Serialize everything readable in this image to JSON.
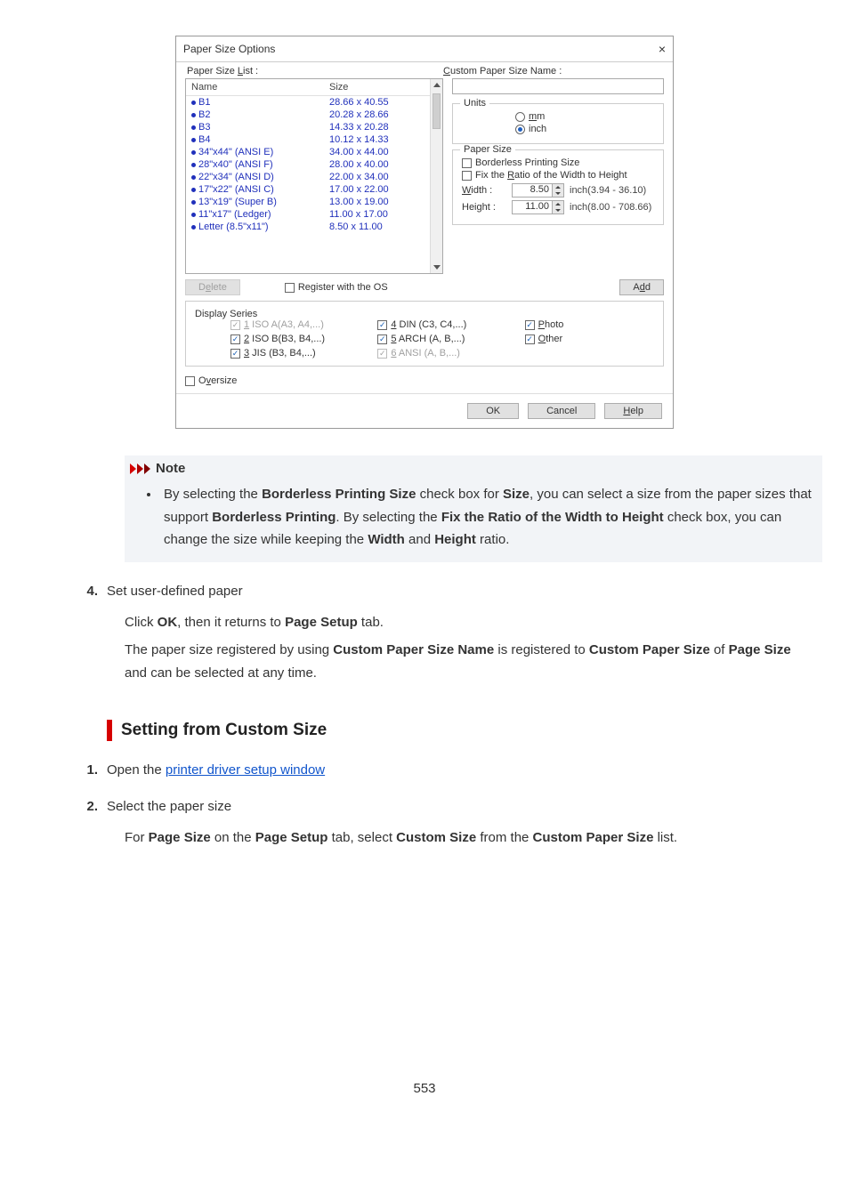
{
  "dialog": {
    "title": "Paper Size Options",
    "close": "×",
    "listLabel": {
      "pre": "Paper Size ",
      "u": "L",
      "post": "ist :"
    },
    "nameLabel": {
      "u": "C",
      "post": "ustom Paper Size Name :"
    },
    "headers": {
      "name": "Name",
      "size": "Size"
    },
    "rows": [
      {
        "name": "B1",
        "size": "28.66 x 40.55"
      },
      {
        "name": "B2",
        "size": "20.28 x 28.66"
      },
      {
        "name": "B3",
        "size": "14.33 x 20.28"
      },
      {
        "name": "B4",
        "size": "10.12 x 14.33"
      },
      {
        "name": "34\"x44\" (ANSI E)",
        "size": "34.00 x 44.00"
      },
      {
        "name": "28\"x40\" (ANSI F)",
        "size": "28.00 x 40.00"
      },
      {
        "name": "22\"x34\" (ANSI D)",
        "size": "22.00 x 34.00"
      },
      {
        "name": "17\"x22\" (ANSI C)",
        "size": "17.00 x 22.00"
      },
      {
        "name": "13\"x19\" (Super B)",
        "size": "13.00 x 19.00"
      },
      {
        "name": "11\"x17\" (Ledger)",
        "size": "11.00 x 17.00"
      },
      {
        "name": "Letter (8.5\"x11\")",
        "size": "8.50 x 11.00"
      }
    ],
    "units": {
      "legend": "Units",
      "mm": {
        "u": "m",
        "post": "m"
      },
      "inch": "inch"
    },
    "paperSize": {
      "legend": "Paper Size",
      "borderless": "Borderless Printing Size",
      "fixRatio": {
        "pre": "Fix the ",
        "u": "R",
        "post": "atio of the Width to Height"
      },
      "widthLbl": {
        "u": "W",
        "post": "idth :"
      },
      "widthVal": "8.50",
      "widthRange": "inch(3.94 - 36.10)",
      "heightLbl": "Height :",
      "heightVal": "11.00",
      "heightRange": "inch(8.00 - 708.66)"
    },
    "deleteBtn": {
      "pre": "D",
      "u": "e",
      "post": "lete"
    },
    "registerOs": "Register with the OS",
    "addBtn": {
      "pre": "A",
      "u": "d",
      "post": "d"
    },
    "displaySeries": {
      "legend": "Display Series",
      "items": [
        {
          "u": "1",
          "post": " ISO A(A3, A4,...)",
          "checked": true,
          "disabled": true
        },
        {
          "u": "4",
          "post": " DIN (C3, C4,...)",
          "checked": true,
          "disabled": false
        },
        {
          "u": "P",
          "label": "hoto",
          "checked": true,
          "disabled": false
        },
        {
          "u": "2",
          "post": " ISO B(B3, B4,...)",
          "checked": true,
          "disabled": false
        },
        {
          "u": "5",
          "post": " ARCH (A, B,...)",
          "checked": true,
          "disabled": false
        },
        {
          "u": "O",
          "label": "ther",
          "checked": true,
          "disabled": false
        },
        {
          "u": "3",
          "post": " JIS (B3, B4,...)",
          "checked": true,
          "disabled": false
        },
        {
          "u": "6",
          "post": " ANSI (A, B,...)",
          "checked": true,
          "disabled": true
        }
      ]
    },
    "oversize": {
      "pre": "O",
      "u": "v",
      "post": "ersize"
    },
    "ok": "OK",
    "cancel": "Cancel",
    "help": {
      "u": "H",
      "post": "elp"
    }
  },
  "note": {
    "label": "Note",
    "text_parts": [
      "By selecting the ",
      "Borderless Printing Size",
      " check box for ",
      "Size",
      ", you can select a size from the paper sizes that support ",
      "Borderless Printing",
      ". By selecting the ",
      "Fix the Ratio of the Width to Height",
      " check box, you can change the size while keeping the ",
      "Width",
      " and ",
      "Height",
      " ratio."
    ]
  },
  "step4": {
    "num": "4.",
    "title": "Set user-defined paper",
    "d1": [
      "Click ",
      "OK",
      ", then it returns to ",
      "Page Setup",
      " tab."
    ],
    "d2": [
      "The paper size registered by using ",
      "Custom Paper Size Name",
      " is registered to ",
      "Custom Paper Size",
      " of ",
      "Page Size",
      " and can be selected at any time."
    ]
  },
  "section": "Setting from Custom Size",
  "step1": {
    "num": "1.",
    "pre": "Open the ",
    "link": "printer driver setup window"
  },
  "step2": {
    "num": "2.",
    "title": "Select the paper size",
    "d": [
      "For ",
      "Page Size",
      " on the ",
      "Page Setup",
      " tab, select ",
      "Custom Size",
      " from the ",
      "Custom Paper Size",
      " list."
    ]
  },
  "pageNum": "553"
}
